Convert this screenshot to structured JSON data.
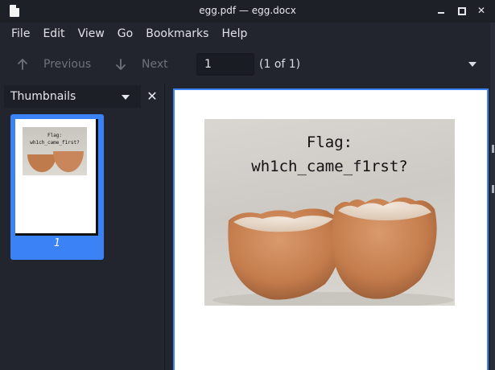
{
  "window": {
    "title": "egg.pdf — egg.docx",
    "app_icon": "document-icon"
  },
  "menubar": {
    "items": [
      "File",
      "Edit",
      "View",
      "Go",
      "Bookmarks",
      "Help"
    ]
  },
  "toolbar": {
    "previous_label": "Previous",
    "next_label": "Next",
    "page_input_value": "1",
    "page_count": "(1 of 1)"
  },
  "sidebar": {
    "mode_label": "Thumbnails",
    "thumbnails": [
      {
        "page_label": "1",
        "flag_text": "Flag:\nwh1ch_came_f1rst?"
      }
    ]
  },
  "document": {
    "flag_line1": "Flag:",
    "flag_line2": "wh1ch_came_f1rst?"
  },
  "colors": {
    "accent": "#3b82f6",
    "background": "#23252e",
    "egg_shell": "#c9865a"
  }
}
